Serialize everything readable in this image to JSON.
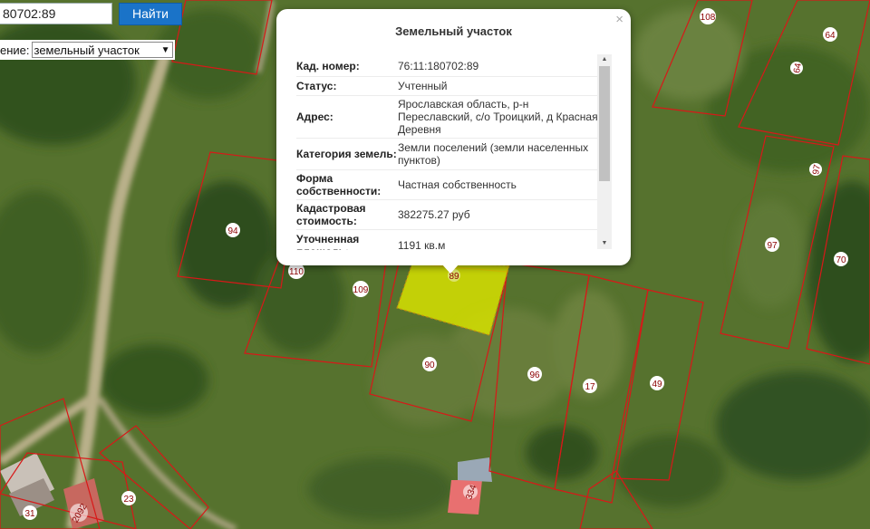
{
  "search": {
    "value": "80702:89",
    "button_label": "Найти"
  },
  "layer": {
    "label": "ение:",
    "selected": "земельный участок"
  },
  "popup": {
    "title": "Земельный участок",
    "close_symbol": "×",
    "rows": [
      {
        "key": "Кад. номер:",
        "value": "76:11:180702:89"
      },
      {
        "key": "Статус:",
        "value": "Учтенный"
      },
      {
        "key": "Адрес:",
        "value": "Ярославская область, р-н Переславский, с/о Троицкий, д Красная Деревня"
      },
      {
        "key": "Категория земель:",
        "value": "Земли поселений (земли населенных пунктов)"
      },
      {
        "key": "Форма собственности:",
        "value": "Частная собственность"
      },
      {
        "key": "Кадастровая стоимость:",
        "value": "382275.27 руб"
      },
      {
        "key": "Уточненная площадь:",
        "value": "1191 кв.м"
      }
    ]
  },
  "map": {
    "parcel_labels": [
      "108",
      "64",
      "64",
      "94",
      "110",
      "109",
      "89",
      "90",
      "96",
      "17",
      "49",
      "97",
      "97",
      "70",
      "334",
      "23",
      "2092",
      "31"
    ],
    "colors": {
      "parcel_border": "#d81818",
      "selected_fill": "#d6e000",
      "roof": "#e87070"
    }
  }
}
